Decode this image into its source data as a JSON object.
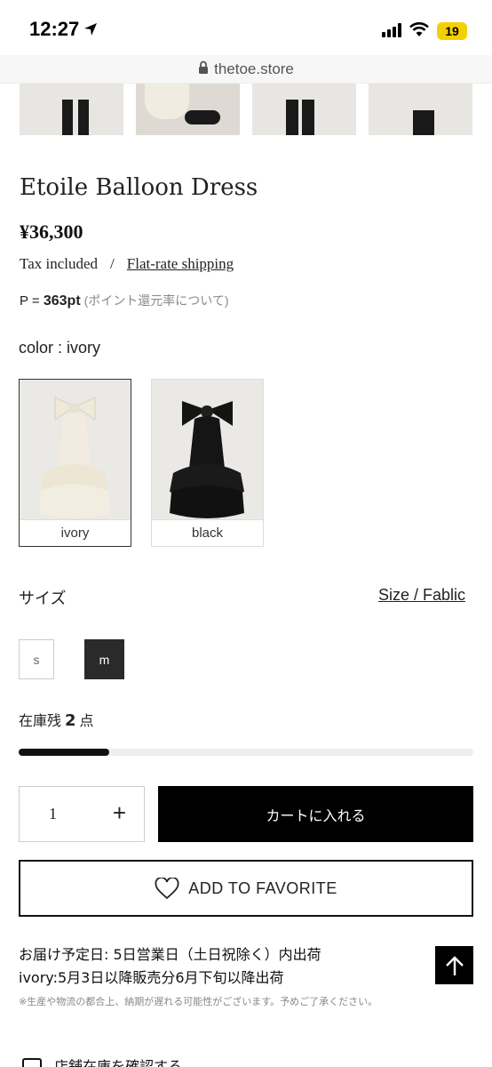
{
  "status_bar": {
    "time": "12:27",
    "battery": "19"
  },
  "browser": {
    "url": "thetoe.store"
  },
  "product": {
    "title": "Etoile Balloon Dress",
    "price": "¥36,300",
    "tax": "Tax included",
    "separator": "/",
    "shipping": "Flat-rate shipping",
    "points_prefix": "P =",
    "points_value": "363pt",
    "points_note": "(ポイント還元率について)"
  },
  "color": {
    "label": "color : ivory",
    "options": [
      {
        "name": "ivory",
        "selected": true,
        "swatch": "#f2ede1"
      },
      {
        "name": "black",
        "selected": false,
        "swatch": "#141414"
      }
    ]
  },
  "size": {
    "label": "サイズ",
    "guide_link": "Size / Fablic",
    "options": [
      {
        "label": "s",
        "selected": false
      },
      {
        "label": "m",
        "selected": true
      }
    ]
  },
  "stock": {
    "prefix": "在庫残",
    "count": "2",
    "suffix": "点",
    "level_fraction": 0.2
  },
  "purchase": {
    "quantity": "1",
    "plus": "+",
    "add_to_cart": "カートに入れる",
    "favorite": "ADD TO FAVORITE"
  },
  "delivery": {
    "line1": "お届け予定日: 5日営業日（土日祝除く）内出荷",
    "line2": "ivory:5月3日以降販売分6月下旬以降出荷",
    "notice": "※生産や物流の都合上、納期が遅れる可能性がございます。予めご了承ください。"
  },
  "store_check": {
    "label": "店舗在庫を確認する"
  }
}
